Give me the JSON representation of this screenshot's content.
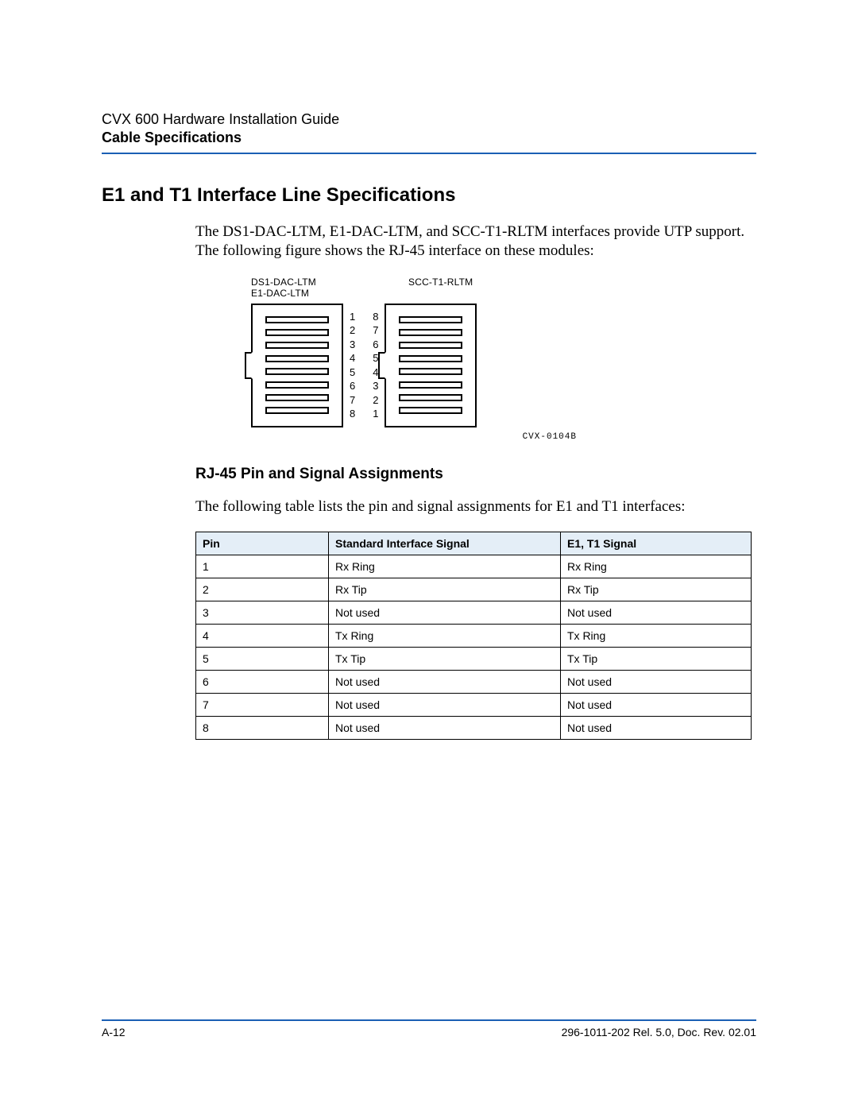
{
  "header": {
    "doc_title": "CVX 600 Hardware Installation Guide",
    "section": "Cable Specifications"
  },
  "heading": "E1 and T1 Interface Line Specifications",
  "intro_para": "The DS1-DAC-LTM, E1-DAC-LTM, and SCC-T1-RLTM interfaces provide UTP support. The following figure shows the RJ-45 interface on these modules:",
  "figure": {
    "left_label_line1": "DS1-DAC-LTM",
    "left_label_line2": "E1-DAC-LTM",
    "right_label": "SCC-T1-RLTM",
    "left_pins": [
      "1",
      "2",
      "3",
      "4",
      "5",
      "6",
      "7",
      "8"
    ],
    "right_pins": [
      "8",
      "7",
      "6",
      "5",
      "4",
      "3",
      "2",
      "1"
    ],
    "id": "CVX-0104B"
  },
  "subheading": "RJ-45 Pin and Signal Assignments",
  "table_intro": "The following table lists the pin and signal assignments for E1 and T1 interfaces:",
  "table": {
    "headers": {
      "pin": "Pin",
      "std": "Standard Interface Signal",
      "e1t1": "E1, T1 Signal"
    },
    "rows": [
      {
        "pin": "1",
        "std": "Rx Ring",
        "e1t1": "Rx Ring"
      },
      {
        "pin": "2",
        "std": "Rx Tip",
        "e1t1": "Rx Tip"
      },
      {
        "pin": "3",
        "std": "Not used",
        "e1t1": "Not used"
      },
      {
        "pin": "4",
        "std": "Tx Ring",
        "e1t1": "Tx Ring"
      },
      {
        "pin": "5",
        "std": "Tx Tip",
        "e1t1": "Tx Tip"
      },
      {
        "pin": "6",
        "std": "Not used",
        "e1t1": "Not used"
      },
      {
        "pin": "7",
        "std": "Not used",
        "e1t1": "Not used"
      },
      {
        "pin": "8",
        "std": "Not used",
        "e1t1": "Not used"
      }
    ]
  },
  "footer": {
    "page_num": "A-12",
    "doc_id": "296-1011-202 Rel. 5.0, Doc. Rev. 02.01"
  }
}
